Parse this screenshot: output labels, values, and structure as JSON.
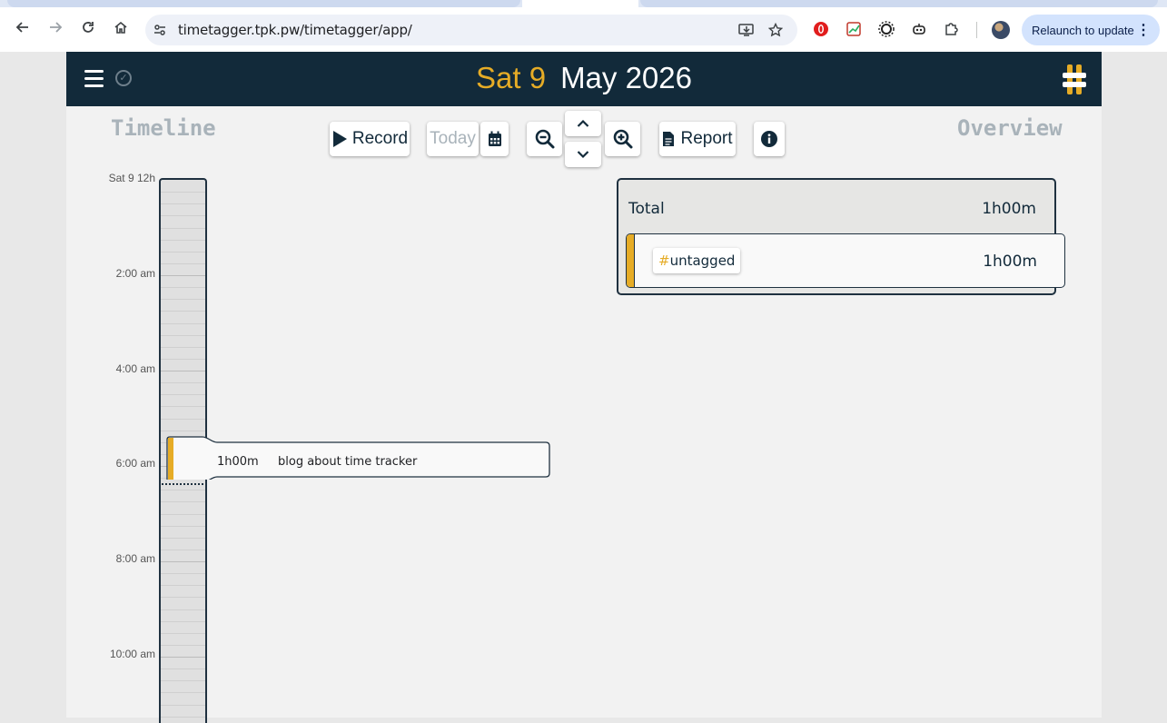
{
  "browser": {
    "url": "timetagger.tpk.pw/timetagger/app/",
    "relaunch_label": "Relaunch to update"
  },
  "header": {
    "day_label": "Sat 9",
    "month_year": "May 2026"
  },
  "toolbar": {
    "record_label": "Record",
    "today_label": "Today",
    "report_label": "Report"
  },
  "sections": {
    "timeline_title": "Timeline",
    "overview_title": "Overview"
  },
  "timeline": {
    "start_label": "Sat 9  12h",
    "ticks": [
      "2:00 am",
      "4:00 am",
      "6:00 am",
      "8:00 am",
      "10:00 am"
    ]
  },
  "record": {
    "duration": "1h00m",
    "description": "blog about time tracker",
    "color": "#e6ac26"
  },
  "overview": {
    "total_label": "Total",
    "total_value": "1h00m",
    "tags": [
      {
        "hash": "#",
        "name": "untagged",
        "value": "1h00m"
      }
    ]
  },
  "colors": {
    "accent": "#e6ac26",
    "header_bg": "#122a3a"
  }
}
